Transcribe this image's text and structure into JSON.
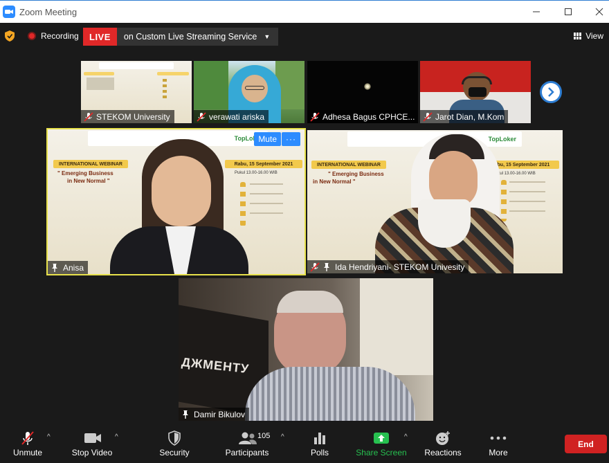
{
  "window": {
    "title": "Zoom Meeting"
  },
  "topbar": {
    "recording_label": "Recording",
    "live_badge": "LIVE",
    "live_text": "on Custom Live Streaming Service",
    "view_label": "View"
  },
  "participants": {
    "small": [
      {
        "name": "STEKOM University",
        "muted": true
      },
      {
        "name": "verawati ariska",
        "muted": true
      },
      {
        "name": "Adhesa Bagus CPHCE...",
        "muted": true
      },
      {
        "name": "Jarot Dian, M.Kom",
        "muted": true
      }
    ],
    "large": [
      {
        "name": "Anisa",
        "pinned": true,
        "mute_label": "Mute",
        "more_label": "···"
      },
      {
        "name": "Ida Hendriyani- STEKOM Univesity",
        "pinned": true,
        "muted": true
      }
    ],
    "bottom": {
      "name": "Damir Bikulov",
      "pinned": true
    }
  },
  "slide": {
    "heading": "INTERNATIONAL WEBINAR",
    "topic_line1": "\" Emerging Business",
    "topic_line2": "in New Normal \"",
    "date": "Rabu, 15 September 2021",
    "time": "Pukul 13.00-16.00 WIB",
    "brand": "TopLoker"
  },
  "background_text": "ДЖМЕНТУ",
  "toolbar": {
    "unmute": "Unmute",
    "stop_video": "Stop Video",
    "security": "Security",
    "participants": "Participants",
    "participants_count": "105",
    "polls": "Polls",
    "share_screen": "Share Screen",
    "reactions": "Reactions",
    "more": "More",
    "end": "End"
  },
  "colors": {
    "live_red": "#e02828",
    "active_speaker": "#e8e24b",
    "share_green": "#27c050",
    "accent_blue": "#2d8cff",
    "end_red": "#d02222"
  }
}
